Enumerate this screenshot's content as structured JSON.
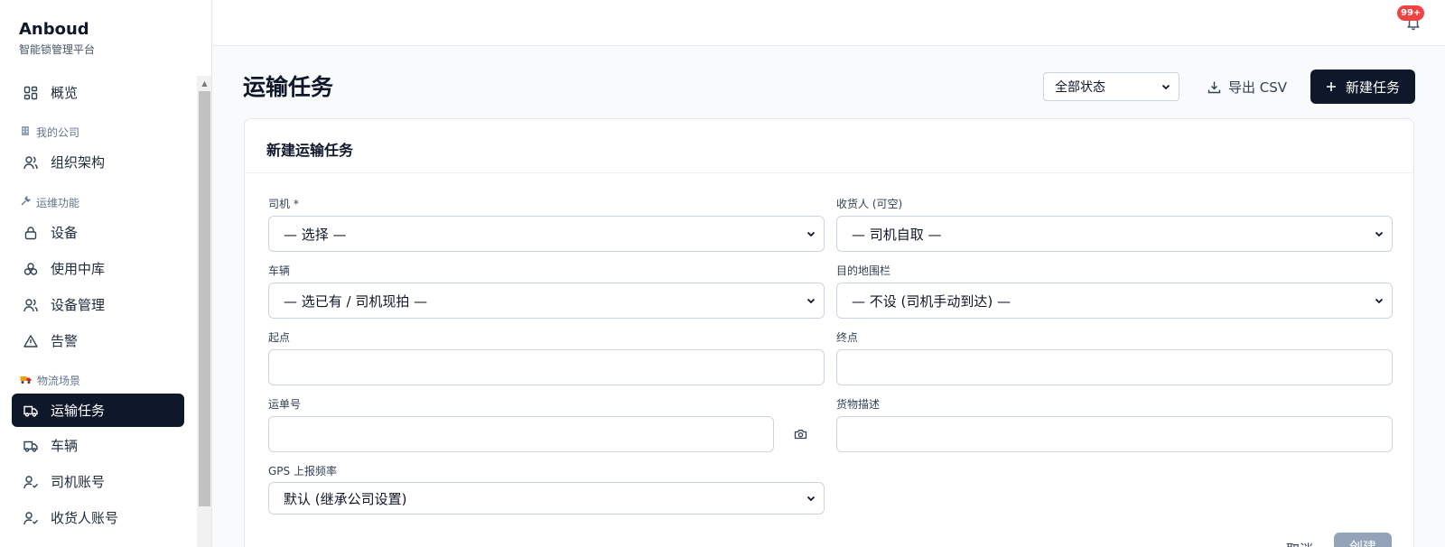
{
  "brand": {
    "title": "Anboud",
    "subtitle": "智能锁管理平台"
  },
  "sidebar": {
    "overview": "概览",
    "group_company": "我的公司",
    "org": "组织架构",
    "group_ops": "运维功能",
    "devices": "设备",
    "warehouse": "使用中库",
    "device_mgmt": "设备管理",
    "alarm": "告警",
    "group_logistics": "物流场景",
    "transport": "运输任务",
    "vehicles": "车辆",
    "drivers": "司机账号",
    "receivers": "收货人账号"
  },
  "topbar": {
    "badge": "99+"
  },
  "header": {
    "title": "运输任务",
    "status_filter": "全部状态",
    "export": "导出 CSV",
    "new_task": "新建任务"
  },
  "form": {
    "title": "新建运输任务",
    "driver_label": "司机 *",
    "driver_value": "— 选择 —",
    "receiver_label": "收货人 (可空)",
    "receiver_value": "— 司机自取 —",
    "vehicle_label": "车辆",
    "vehicle_value": "— 选已有 / 司机现拍 —",
    "geofence_label": "目的地围栏",
    "geofence_value": "— 不设 (司机手动到达) —",
    "origin_label": "起点",
    "origin_value": "",
    "destination_label": "终点",
    "destination_value": "",
    "waybill_label": "运单号",
    "waybill_value": "",
    "cargo_label": "货物描述",
    "cargo_value": "",
    "gps_label": "GPS 上报频率",
    "gps_value": "默认 (继承公司设置)",
    "cancel": "取消",
    "create": "创建"
  },
  "colors": {
    "primary": "#0f172a",
    "badge": "#ef4444",
    "disabled": "#94a3b8"
  }
}
